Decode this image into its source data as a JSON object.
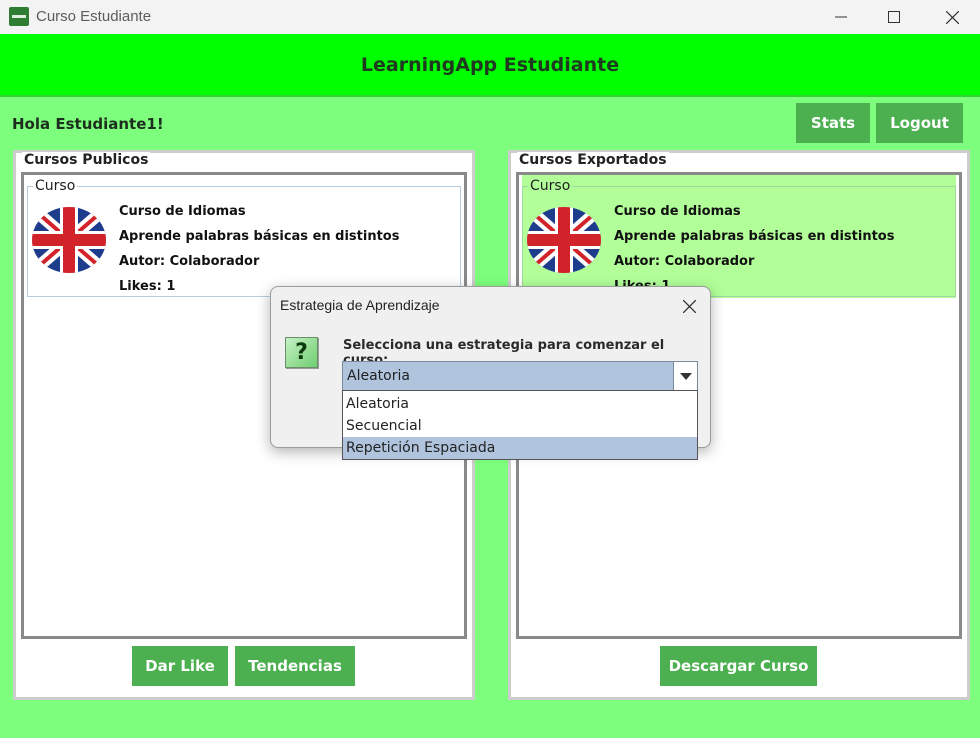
{
  "window": {
    "title": "Curso Estudiante",
    "controls": {
      "minimize": "minimize-icon",
      "maximize": "maximize-icon",
      "close": "close-icon"
    }
  },
  "header": {
    "title": "LearningApp Estudiante"
  },
  "greeting": "Hola Estudiante1!",
  "top_buttons": {
    "stats": "Stats",
    "logout": "Logout"
  },
  "colors": {
    "background": "#7dff7d",
    "header": "#00ff00",
    "button": "#4caf50",
    "selected_card": "#b2ff99",
    "combo_selected": "#b0c4de"
  },
  "public_courses": {
    "title": "Cursos Publicos",
    "cards": [
      {
        "legend": "Curso",
        "name": "Curso de Idiomas",
        "description": "Aprende palabras básicas en distintos",
        "author": "Autor: Colaborador",
        "likes": "Likes: 1",
        "flag_icon": "uk-flag-icon"
      }
    ],
    "buttons": {
      "like": "Dar Like",
      "trends": "Tendencias"
    }
  },
  "exported_courses": {
    "title": "Cursos Exportados",
    "cards": [
      {
        "legend": "Curso",
        "name": "Curso de Idiomas",
        "description": "Aprende palabras básicas en distintos",
        "author": "Autor: Colaborador",
        "likes": "Likes: 1",
        "flag_icon": "uk-flag-icon",
        "selected": true
      }
    ],
    "buttons": {
      "download": "Descargar Curso"
    }
  },
  "dialog": {
    "title": "Estrategia de Aprendizaje",
    "icon": "question-icon",
    "prompt": "Selecciona una estrategia para comenzar el curso:",
    "selected": "Aleatoria",
    "options": [
      "Aleatoria",
      "Secuencial",
      "Repetición Espaciada"
    ],
    "highlighted_option": "Repetición Espaciada"
  }
}
